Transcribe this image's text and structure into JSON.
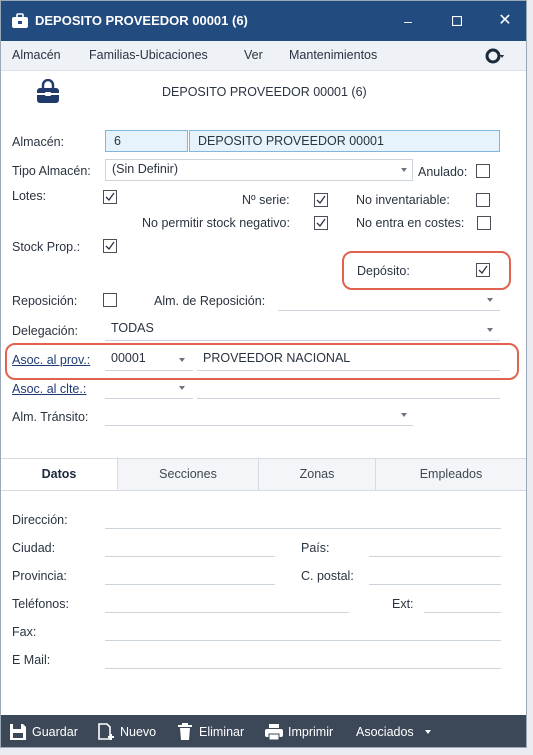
{
  "window": {
    "title": "DEPOSITO PROVEEDOR 00001 (6)"
  },
  "menu": [
    "Almacén",
    "Familias-Ubicaciones",
    "Ver",
    "Mantenimientos"
  ],
  "header": {
    "subtitle": "DEPOSITO PROVEEDOR 00001 (6)"
  },
  "form": {
    "almacen_label": "Almacén:",
    "almacen_code": "6",
    "almacen_name": "DEPOSITO PROVEEDOR 00001",
    "tipo_label": "Tipo Almacén:",
    "tipo_value": "(Sin Definir)",
    "anulado_label": "Anulado:",
    "lotes_label": "Lotes:",
    "nserie_label": "Nº serie:",
    "noinv_label": "No inventariable:",
    "nostock_label": "No permitir stock negativo:",
    "nocostes_label": "No entra en costes:",
    "stockprop_label": "Stock Prop.:",
    "deposito_label": "Depósito:",
    "reposicion_label": "Reposición:",
    "almrepo_label": "Alm. de Reposición:",
    "delegacion_label": "Delegación:",
    "delegacion_value": "TODAS",
    "asocprov_label": "Asoc. al prov.:",
    "asocprov_code": "00001",
    "asocprov_name": "PROVEEDOR NACIONAL",
    "asoccli_label": "Asoc. al clte.:",
    "almtransito_label": "Alm. Tránsito:",
    "checks": {
      "anulado": false,
      "lotes": true,
      "nserie": true,
      "noinv": false,
      "nostock": true,
      "nocostes": false,
      "stockprop": true,
      "deposito": true,
      "reposicion": false
    }
  },
  "tabs": [
    "Datos",
    "Secciones",
    "Zonas",
    "Empleados"
  ],
  "datos": {
    "direccion": "Dirección:",
    "ciudad": "Ciudad:",
    "pais": "País:",
    "provincia": "Provincia:",
    "cpostal": "C. postal:",
    "telefonos": "Teléfonos:",
    "ext": "Ext:",
    "fax": "Fax:",
    "email": "E Mail:"
  },
  "toolbar": {
    "guardar": "Guardar",
    "nuevo": "Nuevo",
    "eliminar": "Eliminar",
    "imprimir": "Imprimir",
    "asociados": "Asociados"
  },
  "icons": [
    "window-app-icon",
    "minimize-icon",
    "maximize-icon",
    "close-icon",
    "settings-icon",
    "lock-bag-icon",
    "save-icon",
    "new-icon",
    "trash-icon",
    "print-icon"
  ],
  "colors": {
    "titlebar": "#224b7f",
    "toolbar": "#3c4858",
    "highlight": "#e0624f",
    "field_fill": "#e6f3fc"
  }
}
